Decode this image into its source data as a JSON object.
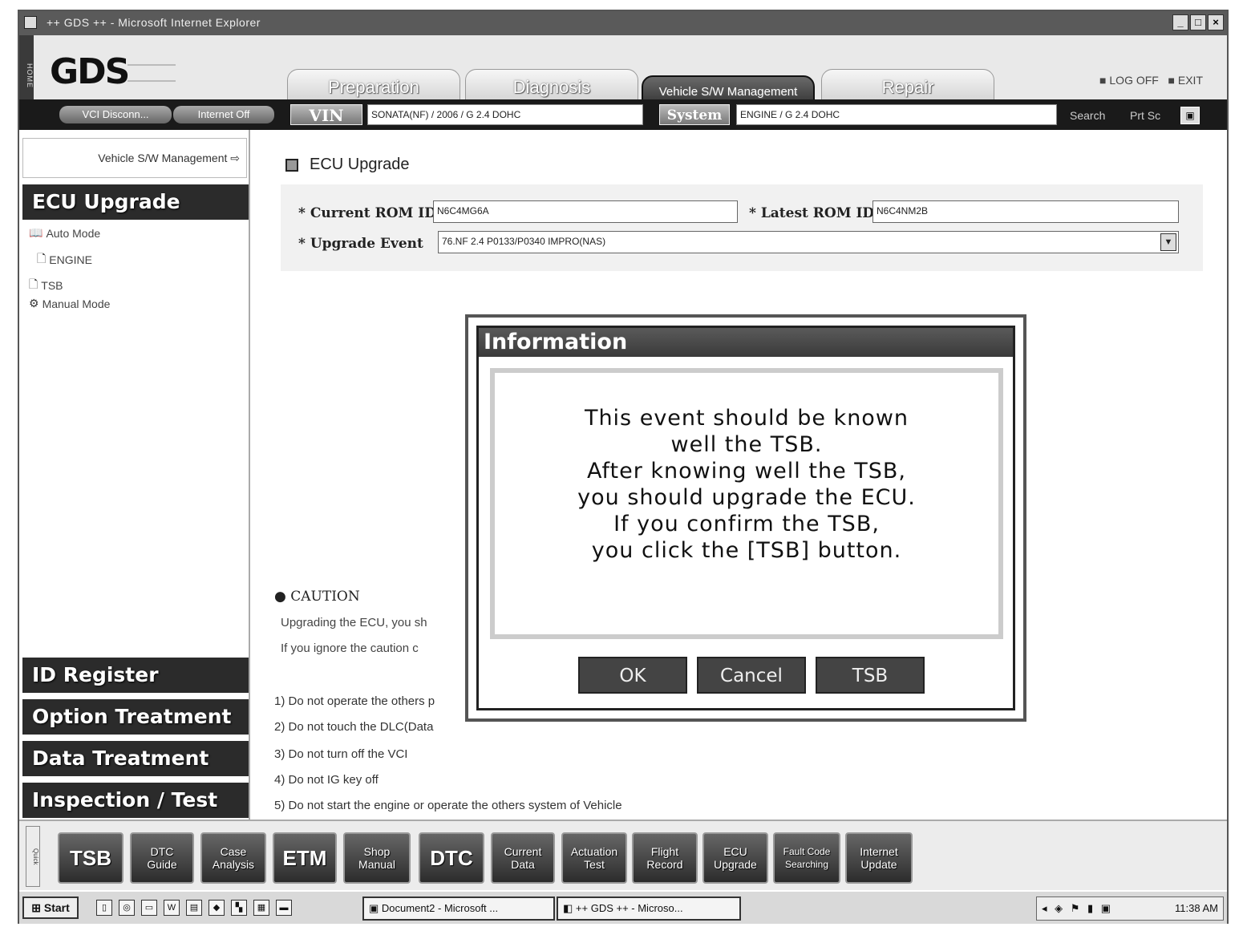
{
  "window": {
    "title": "++ GDS ++ - Microsoft Internet Explorer",
    "controls": [
      "_",
      "□",
      "×"
    ]
  },
  "header": {
    "home_label": "HOME",
    "logo": "GDS",
    "tabs": [
      "Preparation",
      "Diagnosis",
      "Vehicle S/W Management",
      "Repair"
    ],
    "logoff": "LOG OFF",
    "exit": "EXIT"
  },
  "infobar": {
    "vci_status": "VCI Disconn...",
    "internet_status": "Internet Off",
    "vin_label": "VIN",
    "vin_value": "SONATA(NF) / 2006 / G 2.4 DOHC",
    "system_label": "System",
    "system_value": "ENGINE / G 2.4 DOHC",
    "search": "Search",
    "prtsc": "Prt Sc"
  },
  "sidebar": {
    "sw_management": "Vehicle S/W Management",
    "ecu_upgrade": "ECU Upgrade",
    "auto_mode": "Auto Mode",
    "engine": "ENGINE",
    "tsb": "TSB",
    "manual_mode": "Manual Mode",
    "sections": [
      "ID Register",
      "Option Treatment",
      "Data Treatment",
      "Inspection / Test"
    ]
  },
  "main": {
    "title": "ECU Upgrade",
    "current_rom_label": "Current ROM ID",
    "current_rom_value": "N6C4MG6A",
    "latest_rom_label": "Latest ROM ID",
    "latest_rom_value": "N6C4NM2B",
    "event_label": "Upgrade Event",
    "event_value": "76.NF 2.4 P0133/P0340 IMPRO(NAS)",
    "caution_title": "CAUTION",
    "caution_line1": "Upgrading the ECU, you sh",
    "caution_line2": "If you ignore the caution c",
    "rules": [
      "1) Do not operate the others p",
      "2) Do not touch the DLC(Data",
      "3) Do not turn off the VCI",
      "4) Do not IG key off",
      "5) Do not start the engine or operate the others system of Vehicle"
    ]
  },
  "dialog": {
    "title": "Information",
    "message_lines": [
      "This event should be known",
      "well the TSB.",
      "After knowing well the TSB,",
      "you should upgrade the ECU.",
      "If you confirm the TSB,",
      "you click the [TSB] button."
    ],
    "ok": "OK",
    "cancel": "Cancel",
    "tsb": "TSB"
  },
  "toolbar": {
    "quick_label": "Quick",
    "tools": [
      [
        "TSB"
      ],
      [
        "DTC",
        "Guide"
      ],
      [
        "Case",
        "Analysis"
      ],
      [
        "ETM"
      ],
      [
        "Shop",
        "Manual"
      ],
      [
        "DTC"
      ],
      [
        "Current",
        "Data"
      ],
      [
        "Actuation",
        "Test"
      ],
      [
        "Flight",
        "Record"
      ],
      [
        "ECU",
        "Upgrade"
      ],
      [
        "Fault Code",
        "Searching"
      ],
      [
        "Internet",
        "Update"
      ]
    ]
  },
  "taskbar": {
    "start": "Start",
    "item1": "Document2 - Microsoft ...",
    "item2": "++ GDS ++ - Microso...",
    "clock": "11:38 AM"
  }
}
